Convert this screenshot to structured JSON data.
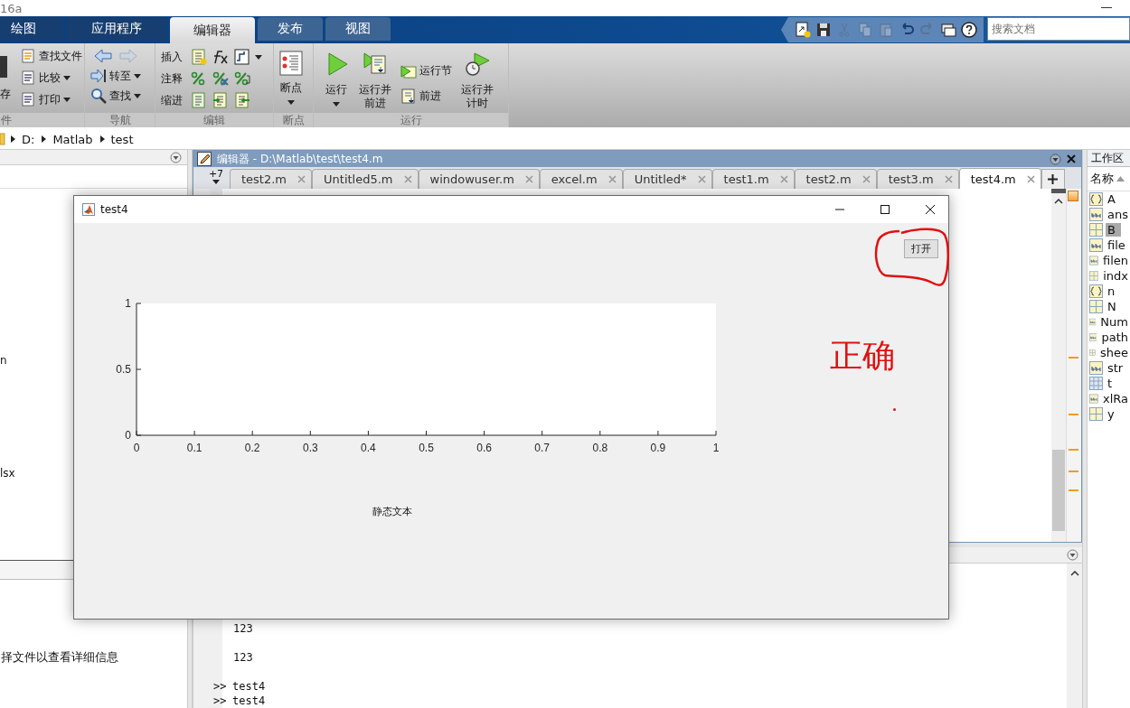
{
  "title_bar": {
    "title": "16a"
  },
  "ribbon": {
    "tabs": [
      {
        "label": "绘图",
        "selected": false
      },
      {
        "label": "应用程序",
        "selected": false
      },
      {
        "label": "编辑器",
        "selected": true
      },
      {
        "label": "发布",
        "selected": false
      },
      {
        "label": "视图",
        "selected": false
      }
    ],
    "quick_access": [
      {
        "disabled": false
      },
      {
        "disabled": false
      },
      {
        "disabled": true
      },
      {
        "disabled": true
      },
      {
        "disabled": true
      },
      {
        "disabled": false
      },
      {
        "disabled": true
      },
      {
        "disabled": false
      },
      {
        "disabled": false
      }
    ],
    "search": {
      "placeholder": "搜索文档"
    },
    "file_group": {
      "label": "件",
      "save_label": "存",
      "buttons": [
        {
          "label": "查找文件",
          "dropdown": false
        },
        {
          "label": "比较",
          "dropdown": true
        },
        {
          "label": "打印",
          "dropdown": true
        }
      ]
    },
    "navigate_group": {
      "label": "导航",
      "back_disabled": false,
      "forward_disabled": true,
      "buttons": [
        {
          "label": "转至",
          "dropdown": true
        },
        {
          "label": "查找",
          "dropdown": true
        }
      ]
    },
    "edit_group": {
      "label": "编辑",
      "rows": [
        {
          "label": "插入",
          "dropdown": true
        },
        {
          "label": "注释",
          "dropdown": false
        },
        {
          "label": "缩进",
          "dropdown": false
        }
      ]
    },
    "breakpoints_group": {
      "label": "断点",
      "button": {
        "label": "断点",
        "dropdown": true
      }
    },
    "run_group": {
      "label": "运行",
      "buttons": [
        {
          "kind": "large",
          "lines": [
            "运行"
          ],
          "dropdown": true
        },
        {
          "kind": "large",
          "lines": [
            "运行并",
            "前进"
          ],
          "dropdown": false
        },
        {
          "kind": "stack",
          "items": [
            "运行节",
            "前进"
          ]
        },
        {
          "kind": "large",
          "lines": [
            "运行并",
            "计时"
          ],
          "dropdown": false
        }
      ]
    }
  },
  "path_bar": {
    "segments": [
      "D:",
      "Matlab",
      "test"
    ]
  },
  "current_folder": {
    "items": [
      "n",
      "lsx"
    ],
    "details_hint": "择文件以查看详细信息"
  },
  "editor": {
    "title": "编辑器 - D:\\Matlab\\test\\test4.m",
    "overflow_tabs": "+7",
    "tabs": [
      {
        "label": "test2.m",
        "selected": false
      },
      {
        "label": "Untitled5.m",
        "selected": false
      },
      {
        "label": "windowuser.m",
        "selected": false
      },
      {
        "label": "excel.m",
        "selected": false
      },
      {
        "label": "Untitled*",
        "selected": false
      },
      {
        "label": "test1.m",
        "selected": false
      },
      {
        "label": "test2.m",
        "selected": false
      },
      {
        "label": "test3.m",
        "selected": false
      },
      {
        "label": "test4.m",
        "selected": true
      }
    ]
  },
  "command_window": {
    "lines": [
      {
        "kind": "output",
        "text": "123"
      },
      {
        "kind": "output",
        "text": "123"
      },
      {
        "kind": "command",
        "prompt": ">>",
        "text": "test4"
      },
      {
        "kind": "command",
        "prompt": ">>",
        "text": "test4"
      }
    ]
  },
  "workspace": {
    "title": "工作区",
    "column": "名称",
    "variables": [
      {
        "name": "A",
        "kind": "struct",
        "selected": false
      },
      {
        "name": "ans",
        "kind": "char",
        "selected": false
      },
      {
        "name": "B",
        "kind": "matrix",
        "selected": true
      },
      {
        "name": "file",
        "kind": "char",
        "selected": false
      },
      {
        "name": "filen",
        "kind": "char",
        "selected": false
      },
      {
        "name": "indx",
        "kind": "matrix",
        "selected": false
      },
      {
        "name": "n",
        "kind": "struct",
        "selected": false
      },
      {
        "name": "N",
        "kind": "matrix",
        "selected": false
      },
      {
        "name": "Num",
        "kind": "char",
        "selected": false
      },
      {
        "name": "path",
        "kind": "char",
        "selected": false
      },
      {
        "name": "shee",
        "kind": "matrix",
        "selected": false
      },
      {
        "name": "str",
        "kind": "char",
        "selected": false
      },
      {
        "name": "t",
        "kind": "table",
        "selected": false
      },
      {
        "name": "xlRa",
        "kind": "char",
        "selected": false
      },
      {
        "name": "y",
        "kind": "matrix",
        "selected": false
      }
    ]
  },
  "figure": {
    "title": "test4",
    "axes": {
      "chart_data": {
        "type": "line",
        "xlim": [
          0,
          1
        ],
        "ylim": [
          0,
          1
        ],
        "xticks": [
          0,
          0.1,
          0.2,
          0.3,
          0.4,
          0.5,
          0.6,
          0.7,
          0.8,
          0.9,
          1
        ],
        "yticks": [
          0,
          0.5,
          1
        ]
      }
    },
    "static_text": "静态文本",
    "button": "打开"
  },
  "annotation": {
    "text": "正确"
  }
}
